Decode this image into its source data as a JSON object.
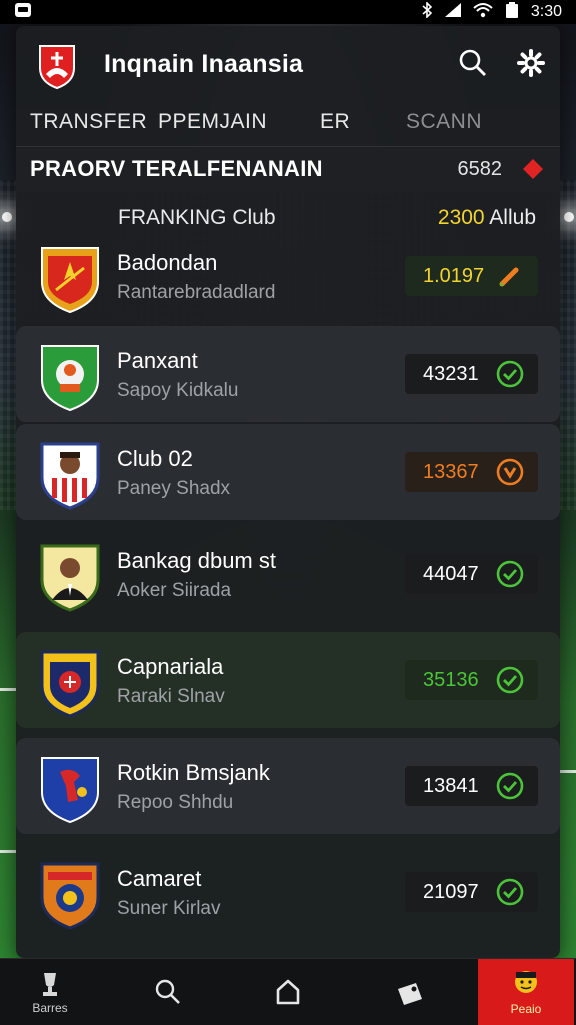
{
  "status": {
    "time": "3:30"
  },
  "app": {
    "title": "Inqnain Inaansia"
  },
  "tabs": [
    {
      "label": "TRANSFER",
      "active": true
    },
    {
      "label": "PPEMJAIN",
      "active": true
    },
    {
      "label": "ER",
      "active": true
    },
    {
      "label": "SCANN",
      "active": false
    }
  ],
  "section": {
    "title": "PRAORV TERALFENANAIN",
    "count": "6582"
  },
  "columns": {
    "left": "FRANKING Club",
    "right_number": "2300",
    "right_text": "Allub"
  },
  "clubs": [
    {
      "name": "Badondan",
      "sub": "Rantarebradadlard",
      "value": "1.0197",
      "value_color": "#f2d431",
      "status_icon": "edit-icon",
      "status_color": "#ee7d22"
    },
    {
      "name": "Panxant",
      "sub": "Sapoy Kidkalu",
      "value": "43231",
      "value_color": "#ffffff",
      "status_icon": "check-circle-icon",
      "status_color": "#4cc43a"
    },
    {
      "name": "Club 02",
      "sub": "Paney Shadx",
      "value": "13367",
      "value_color": "#ee7d22",
      "status_icon": "alert-circle-icon",
      "status_color": "#ee7d22"
    },
    {
      "name": "Bankag dbum st",
      "sub": "Aoker Siirada",
      "value": "44047",
      "value_color": "#ffffff",
      "status_icon": "check-circle-icon",
      "status_color": "#4cc43a"
    },
    {
      "name": "Capnariala",
      "sub": "Raraki Slnav",
      "value": "35136",
      "value_color": "#4cc43a",
      "status_icon": "check-circle-icon",
      "status_color": "#4cc43a"
    },
    {
      "name": "Rotkin Bmsjank",
      "sub": "Repoo Shhdu",
      "value": "13841",
      "value_color": "#ffffff",
      "status_icon": "check-circle-icon",
      "status_color": "#4cc43a"
    },
    {
      "name": "Camaret",
      "sub": "Suner Kirlav",
      "value": "21097",
      "value_color": "#ffffff",
      "status_icon": "check-circle-icon",
      "status_color": "#4cc43a"
    }
  ],
  "nav": [
    {
      "label": "Barres",
      "icon": "trophy-icon"
    },
    {
      "label": "",
      "icon": "search-icon"
    },
    {
      "label": "",
      "icon": "home-icon"
    },
    {
      "label": "",
      "icon": "transfer-tag-icon"
    },
    {
      "label": "Peaio",
      "icon": "player-face-icon",
      "active": true
    }
  ],
  "colors": {
    "accent_red": "#d91a1a",
    "accent_yellow": "#f2d431",
    "success_green": "#4cc43a",
    "warning_orange": "#ee7d22"
  }
}
